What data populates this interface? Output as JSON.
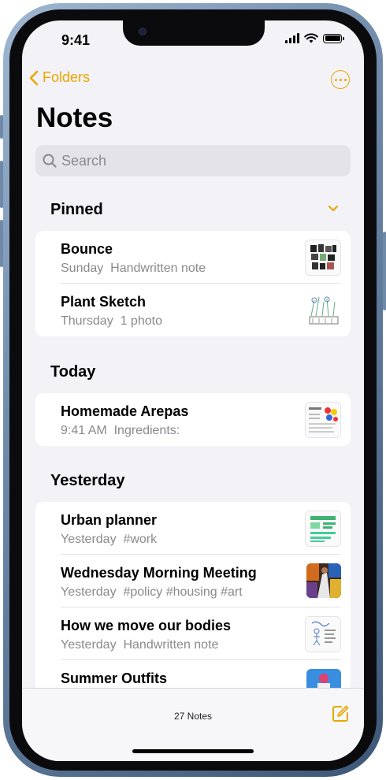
{
  "status": {
    "time": "9:41"
  },
  "nav": {
    "back_label": "Folders"
  },
  "header": {
    "title": "Notes"
  },
  "search": {
    "placeholder": "Search"
  },
  "sections": {
    "pinned": {
      "title": "Pinned",
      "notes": [
        {
          "title": "Bounce",
          "subtitle": "Sunday  Handwritten note"
        },
        {
          "title": "Plant Sketch",
          "subtitle": "Thursday  1 photo"
        }
      ]
    },
    "today": {
      "title": "Today",
      "notes": [
        {
          "title": "Homemade Arepas",
          "subtitle": "9:41 AM  Ingredients:"
        }
      ]
    },
    "yesterday": {
      "title": "Yesterday",
      "notes": [
        {
          "title": "Urban planner",
          "subtitle": "Yesterday  #work"
        },
        {
          "title": "Wednesday Morning Meeting",
          "subtitle": "Yesterday  #policy #housing #art"
        },
        {
          "title": "How we move our bodies",
          "subtitle": "Yesterday  Handwritten note"
        },
        {
          "title": "Summer Outfits",
          "subtitle": ""
        }
      ]
    }
  },
  "toolbar": {
    "count": "27 Notes"
  },
  "colors": {
    "accent": "#e8a800",
    "background": "#f2f2f7",
    "frame": "#6d88a8"
  }
}
